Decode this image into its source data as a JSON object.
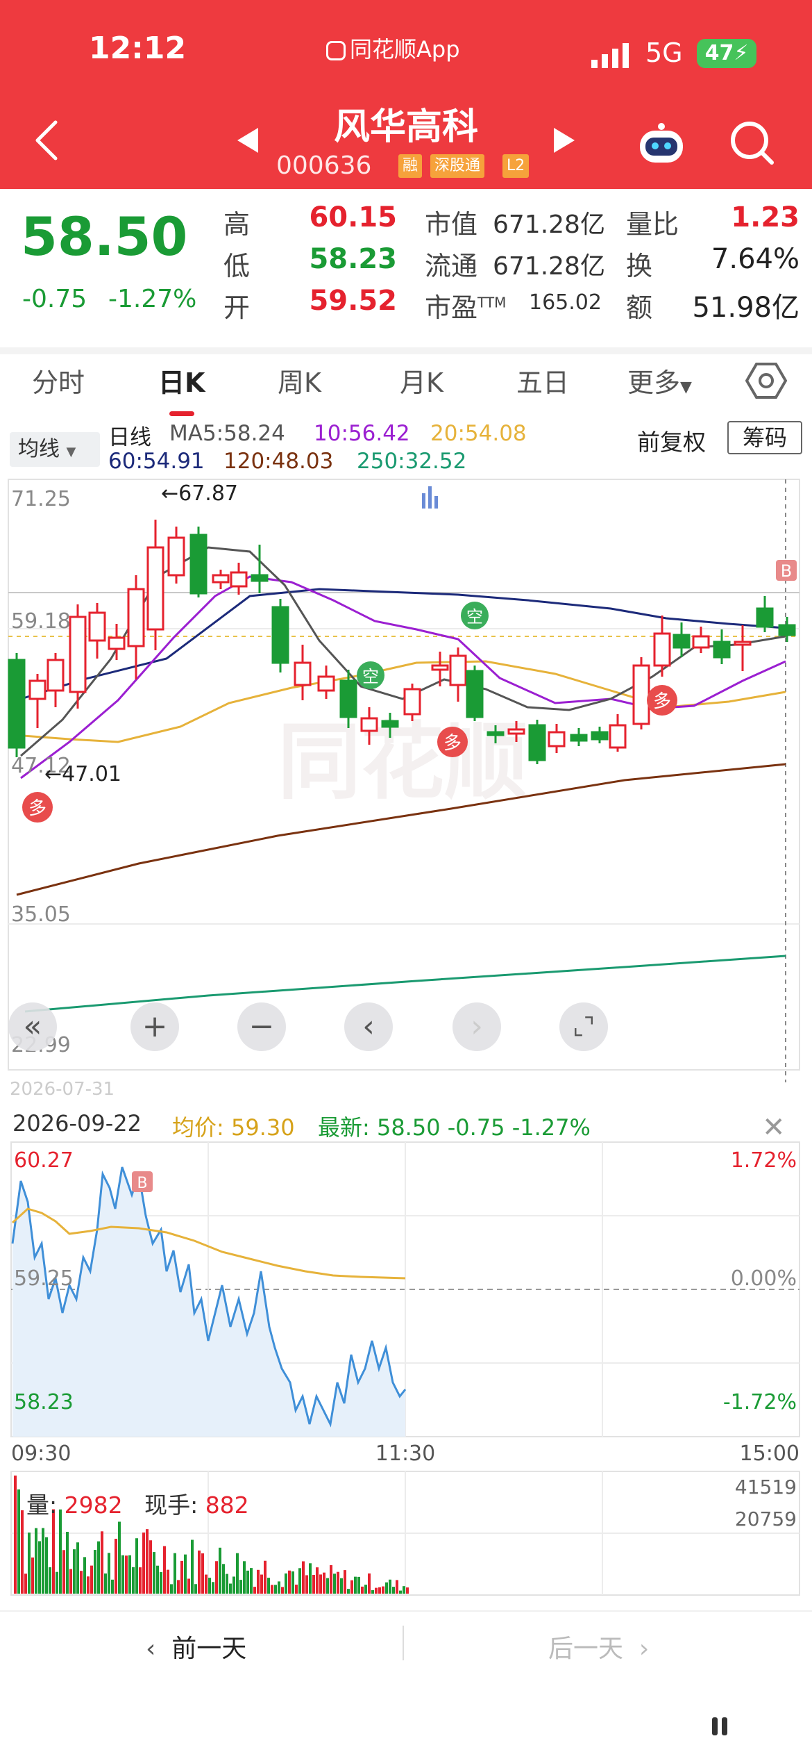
{
  "status": {
    "time": "12:12",
    "app": "同花顺App",
    "network": "5G",
    "battery": "47"
  },
  "stock": {
    "name": "风华高科",
    "code": "000636",
    "tags": [
      "融",
      "深股通",
      "L2"
    ]
  },
  "quote": {
    "price": "58.50",
    "change": "-0.75",
    "change_pct": "-1.27%",
    "high_label": "高",
    "high": "60.15",
    "low_label": "低",
    "low": "58.23",
    "open_label": "开",
    "open": "59.52",
    "mcap_label": "市值",
    "mcap": "671.28亿",
    "float_label": "流通",
    "float": "671.28亿",
    "pe_label": "市盈",
    "pe_sup": "TTM",
    "pe": "165.02",
    "volratio_label": "量比",
    "volratio": "1.23",
    "turnover_label": "换",
    "turnover": "7.64%",
    "amount_label": "额",
    "amount": "51.98亿"
  },
  "tabs": [
    "分时",
    "日K",
    "周K",
    "月K",
    "五日",
    "更多"
  ],
  "indicator": {
    "select": "均线",
    "line_type": "日线",
    "ma5": "MA5:58.24",
    "ma10": "10:56.42",
    "ma20": "20:54.08",
    "ma60": "60:54.91",
    "ma120": "120:48.03",
    "ma250": "250:32.52",
    "adjust": "前复权",
    "chip": "筹码"
  },
  "kline": {
    "y_labels": [
      "71.25",
      "59.18",
      "47.12",
      "35.05",
      "22.99"
    ],
    "max_label": "←67.87",
    "min_label": "←47.01",
    "markers": {
      "duo": "多",
      "kong": "空",
      "buy": "B"
    },
    "date_partial": "2026-07-31"
  },
  "intraday": {
    "date": "2026-09-22",
    "avg": "均价: 59.30",
    "last": "最新: 58.50  -0.75  -1.27%",
    "high": "60.27",
    "mid": "59.25",
    "low": "58.23",
    "pct_high": "1.72%",
    "pct_mid": "0.00%",
    "pct_low": "-1.72%",
    "time_start": "09:30",
    "time_mid": "11:30",
    "time_end": "15:00",
    "vol_label": "量: ",
    "vol": "2982",
    "hand_label": "现手: ",
    "hand": "882",
    "vol_max": "41519",
    "vol_mid": "20759",
    "buy": "B"
  },
  "nav": {
    "prev": "前一天",
    "next": "后一天"
  },
  "colors": {
    "header": "#ee3a3f",
    "up": "#e5222e",
    "down": "#1a9b35",
    "ma5": "#555555",
    "ma10": "#9b1fd1",
    "ma20": "#e6b23a",
    "ma60": "#1c2a7a",
    "ma120": "#7a3210",
    "ma250": "#1a9a70"
  }
}
